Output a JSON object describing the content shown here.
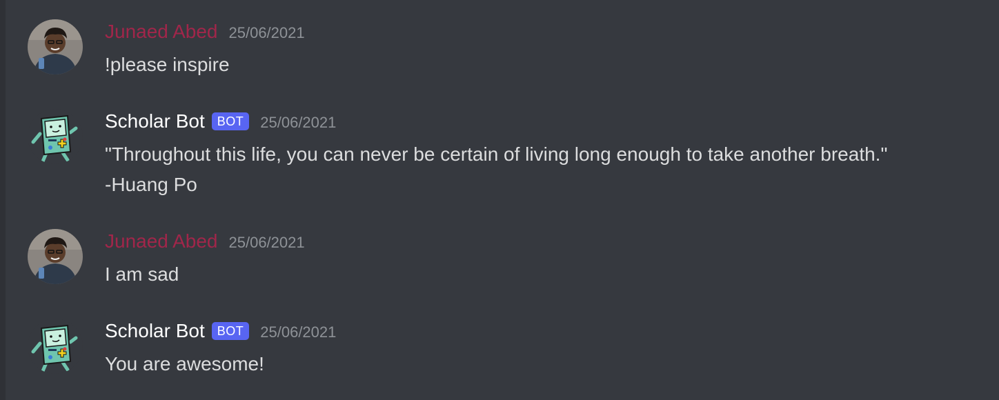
{
  "messages": [
    {
      "author": "Junaed Abed",
      "is_bot": false,
      "timestamp": "25/06/2021",
      "content": "!please inspire"
    },
    {
      "author": "Scholar Bot",
      "is_bot": true,
      "badge": "BOT",
      "timestamp": "25/06/2021",
      "content": "\"Throughout this life, you can never be certain of living long enough to take another breath.\" -Huang Po"
    },
    {
      "author": "Junaed Abed",
      "is_bot": false,
      "timestamp": "25/06/2021",
      "content": "I am sad"
    },
    {
      "author": "Scholar Bot",
      "is_bot": true,
      "badge": "BOT",
      "timestamp": "25/06/2021",
      "content": "You are awesome!"
    }
  ],
  "colors": {
    "background": "#36393f",
    "human_name": "#a1264a",
    "bot_name": "#ffffff",
    "bot_badge": "#5865f2",
    "timestamp": "#8e9297",
    "message_text": "#dcddde"
  },
  "icons": {
    "user_avatar": "user-photo-avatar",
    "bot_avatar": "bmo-robot-avatar"
  }
}
